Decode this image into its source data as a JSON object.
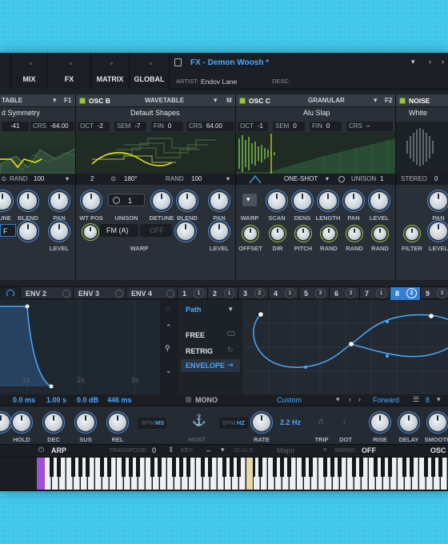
{
  "header": {
    "tabs": [
      "MIX",
      "FX",
      "MATRIX",
      "GLOBAL"
    ],
    "preset_name": "FX - Demon Woosh *",
    "artist_label": "ARTIST:",
    "artist": "Endov Lane",
    "desc_label": "DESC:"
  },
  "osc_a": {
    "type": "TABLE",
    "routing": "F1",
    "wavetable": "d Symmetry",
    "pan_value": "-41",
    "crs_label": "CRS",
    "crs_value": "-64.00",
    "rand_label": "RAND",
    "rand_value": "100",
    "knobs": [
      "UNE",
      "BLEND",
      "PAN",
      "LEVEL"
    ],
    "warp": "F"
  },
  "osc_b": {
    "title": "OSC B",
    "type": "WAVETABLE",
    "routing": "M",
    "wavetable": "Default Shapes",
    "oct_label": "OCT",
    "oct": "-2",
    "sem_label": "SEM",
    "sem": "-7",
    "fin_label": "FIN",
    "fin": "0",
    "crs_label": "CRS",
    "crs": "64.00",
    "unison": "2",
    "phase": "180°",
    "rand_label": "RAND",
    "rand": "100",
    "knobs": [
      "WT POS",
      "UNISON",
      "DETUNE",
      "BLEND",
      "PAN",
      "LEVEL"
    ],
    "unison_count": "1",
    "warp_mode": "FM (A)",
    "warp_off": "OFF",
    "warp_label": "WARP"
  },
  "osc_c": {
    "title": "OSC C",
    "type": "GRANULAR",
    "routing": "F2",
    "sample": "Alu Slap",
    "oct_label": "OCT",
    "oct": "-1",
    "sem_label": "SEM",
    "sem": "0",
    "fin_label": "FIN",
    "fin": "0",
    "crs_label": "CRS",
    "crs": "–",
    "mode": "ONE-SHOT",
    "unison_label": "UNISON",
    "unison": "1",
    "knobs_top": [
      "WARP",
      "SCAN",
      "DENS",
      "LENGTH",
      "PAN",
      "LEVEL"
    ],
    "knobs_bottom": [
      "OFFSET",
      "DIR",
      "PITCH",
      "RAND",
      "RAND",
      "RAND"
    ]
  },
  "noise": {
    "title": "NOISE",
    "type": "White",
    "stereo_label": "STEREO",
    "stereo": "0",
    "knobs": [
      "PAN",
      "FILTER",
      "LEVEL"
    ]
  },
  "mod": {
    "env_tabs": [
      "ENV 2",
      "ENV 3",
      "ENV 4"
    ],
    "lfo_tabs": [
      "1",
      "2",
      "3",
      "4",
      "5",
      "6",
      "7",
      "8",
      "9"
    ],
    "lfo_nums": [
      "1",
      "1",
      "2",
      "1",
      "3",
      "3",
      "1",
      "2",
      "3"
    ],
    "env_values": [
      "0.0 ms",
      "1.00 s",
      "0.0 dB",
      "446 ms"
    ],
    "env_knobs": [
      "HOLD",
      "DEC",
      "SUS",
      "REL"
    ],
    "bpm": "BPM",
    "ms": "MS",
    "grid_labels": [
      "1s",
      "2s",
      "3s"
    ],
    "lfo_mode": "Path",
    "lfo_options": [
      "FREE",
      "RETRIG",
      "ENVELOPE"
    ],
    "mono": "MONO",
    "shape": "Custom",
    "direction": "Forward",
    "grid_count": "8",
    "rate_bpm": "BPM",
    "rate_hz": "HZ",
    "rate_value": "2.2 Hz",
    "lfo_knobs": [
      "HOST",
      "RATE",
      "TRIP",
      "DOT",
      "RISE",
      "DELAY",
      "SMOOTH"
    ]
  },
  "keys": {
    "arp": "ARP",
    "transpose_label": "TRANSPOSE:",
    "transpose": "0",
    "key_label": "KEY:",
    "key": "–",
    "scale_label": "SCALE:",
    "scale": "Major",
    "swing_label": "SWING:",
    "swing": "OFF",
    "osc_label": "OSC E"
  },
  "colors": {
    "background": "#3fc6ea",
    "accent_green": "#97c93b",
    "accent_blue": "#2f7fd4",
    "accent_yellow": "#e8e21a",
    "panel": "#2a3038"
  }
}
